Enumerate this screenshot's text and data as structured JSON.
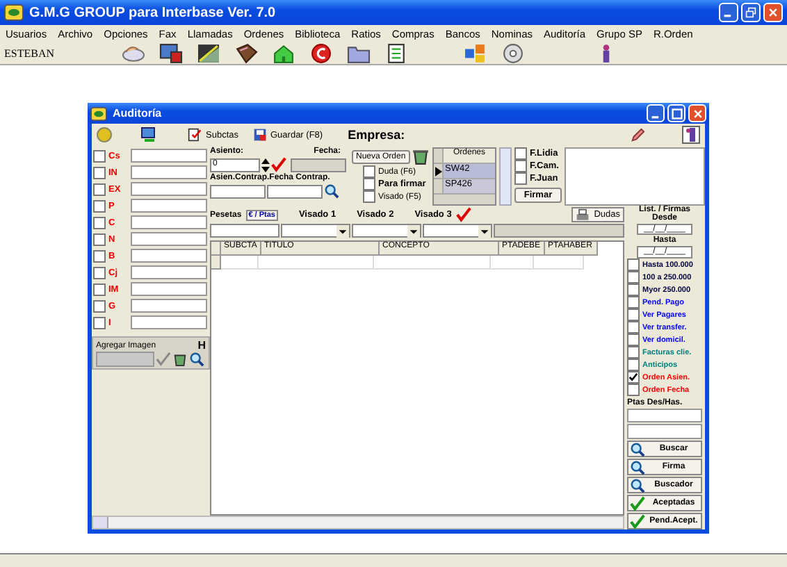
{
  "window": {
    "title": "G.M.G GROUP para Interbase Ver. 7.0"
  },
  "menu": [
    "Usuarios",
    "Archivo",
    "Opciones",
    "Fax",
    "Llamadas",
    "Ordenes",
    "Biblioteca",
    "Ratios",
    "Compras",
    "Bancos",
    "Nominas",
    "Auditoría",
    "Grupo SP",
    "R.Orden"
  ],
  "toolbar": {
    "user": "ESTEBAN"
  },
  "child_window": {
    "title": "Auditoría",
    "toolbar": {
      "buttons": [
        "Subctas",
        "Guardar (F8)"
      ],
      "empresa_label": "Empresa:"
    },
    "filters": [
      {
        "code": "Cs",
        "checked": false
      },
      {
        "code": "IN",
        "checked": false
      },
      {
        "code": "EX",
        "checked": false
      },
      {
        "code": "P",
        "checked": false
      },
      {
        "code": "C",
        "checked": false
      },
      {
        "code": "N",
        "checked": false
      },
      {
        "code": "B",
        "checked": false
      },
      {
        "code": "Cj",
        "checked": false
      },
      {
        "code": "IM",
        "checked": false
      },
      {
        "code": "G",
        "checked": false
      },
      {
        "code": "I",
        "checked": false
      }
    ],
    "image_panel": {
      "label": "Agregar Imagen",
      "h_label": "H"
    },
    "asiento": {
      "label": "Asiento:",
      "value": "0"
    },
    "fecha": {
      "label": "Fecha:"
    },
    "contrap_label": "Asien.Contrap.Fecha Contrap.",
    "nueva_orden": "Nueva Orden",
    "flags": [
      {
        "label": "Duda  (F6)",
        "checked": false,
        "bold": false
      },
      {
        "label": "Para firmar",
        "checked": false,
        "bold": true
      },
      {
        "label": "Visado (F5)",
        "checked": false,
        "bold": false
      }
    ],
    "ordenes": {
      "header": "Ordenes",
      "rows": [
        {
          "value": "SW42",
          "selected": true
        },
        {
          "value": "SP426",
          "selected": false
        }
      ]
    },
    "firmantes": [
      {
        "label": "F.Lidia",
        "checked": false
      },
      {
        "label": "F.Cam.",
        "checked": false
      },
      {
        "label": "F.Juan",
        "checked": false
      }
    ],
    "firmar_button": "Firmar",
    "currency": {
      "label": "Pesetas",
      "toggle": "€ / Ptas"
    },
    "visados": [
      "Visado 1",
      "Visado 2",
      "Visado 3"
    ],
    "dudas_button": "Dudas",
    "table": {
      "columns": [
        "SUBCTA",
        "TITULO",
        "CONCEPTO",
        "PTADEBE",
        "PTAHABER"
      ]
    },
    "side": {
      "list_label": "List. / Firmas Desde",
      "desde": "__/__/____",
      "hasta_label": "Hasta",
      "hasta": "__/__/____",
      "options": [
        {
          "label": "Hasta 100.000",
          "checked": false,
          "color": "#000040"
        },
        {
          "label": "100 a 250.000",
          "checked": false,
          "color": "#000040"
        },
        {
          "label": "Myor 250.000",
          "checked": false,
          "color": "#000040"
        },
        {
          "label": "Pend. Pago",
          "checked": false,
          "color": "#0000ff"
        },
        {
          "label": "Ver Pagares",
          "checked": false,
          "color": "#0000ff"
        },
        {
          "label": "Ver transfer.",
          "checked": false,
          "color": "#0000ff"
        },
        {
          "label": "Ver domicil.",
          "checked": false,
          "color": "#0000ff"
        },
        {
          "label": "Facturas clie.",
          "checked": false,
          "color": "#008080"
        },
        {
          "label": "Anticipos",
          "checked": false,
          "color": "#008080"
        },
        {
          "label": "Orden Asien.",
          "checked": true,
          "color": "#ff0000"
        },
        {
          "label": "Orden Fecha",
          "checked": false,
          "color": "#ff0000"
        }
      ],
      "ptas_label": "Ptas Des/Has.",
      "actions": [
        {
          "label": "Buscar",
          "kind": "search"
        },
        {
          "label": "Firma",
          "kind": "search"
        },
        {
          "label": "Buscador",
          "kind": "search"
        },
        {
          "label": "Aceptadas",
          "kind": "check"
        },
        {
          "label": "Pend.Acept.",
          "kind": "check"
        }
      ]
    }
  }
}
